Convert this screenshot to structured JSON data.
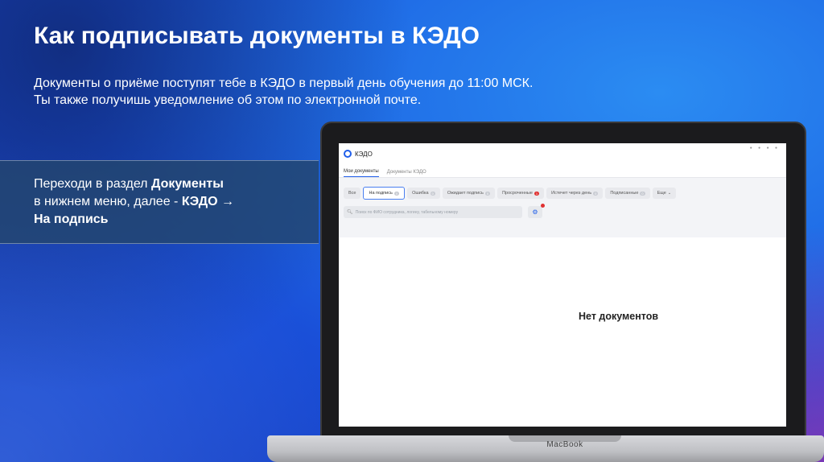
{
  "slide": {
    "title": "Как подписывать документы в КЭДО",
    "subtitle_line1": "Документы о приёме поступят тебе в КЭДО в первый день обучения до 11:00 МСК.",
    "subtitle_line2": "Ты также получишь уведомление об этом по электронной почте.",
    "callout_line1_prefix": "Переходи в раздел ",
    "callout_line1_bold": "Документы",
    "callout_line2_prefix": "в нижнем меню, далее - ",
    "callout_line2_bold": "КЭДО →",
    "callout_line3_bold": "На подпись",
    "device_label": "MacBook"
  },
  "app": {
    "name": "КЭДО",
    "tabs": [
      "Мои документы",
      "Документы КЭДО"
    ],
    "active_tab": "Мои документы",
    "filters": [
      {
        "label": "Все",
        "count": ""
      },
      {
        "label": "На подпись",
        "count": "0"
      },
      {
        "label": "Ошибка",
        "count": "0"
      },
      {
        "label": "Ожидает подпись",
        "count": "0"
      },
      {
        "label": "Просроченные",
        "count": "1"
      },
      {
        "label": "Истечет через день",
        "count": "0"
      },
      {
        "label": "Подписанные",
        "count": "0"
      },
      {
        "label": "Еще",
        "count": ""
      }
    ],
    "active_filter": "На подпись",
    "search_placeholder": "Поиск по ФИО сотрудника, логину, табельному номеру",
    "empty_message": "Нет документов"
  },
  "colors": {
    "accent": "#1f5eea",
    "alert": "#e03131"
  }
}
